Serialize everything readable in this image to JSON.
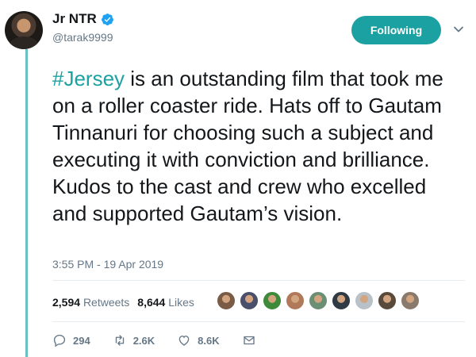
{
  "user": {
    "display_name": "Jr NTR",
    "handle": "@tarak9999",
    "follow_label": "Following"
  },
  "tweet": {
    "hashtag": "#Jersey",
    "body": " is an outstanding film that took me on a roller coaster ride. Hats off to Gautam Tinnanuri for choosing such a subject and executing it with conviction and brilliance. Kudos to the cast and crew who excelled and supported Gautam’s vision.",
    "timestamp": "3:55 PM - 19 Apr 2019"
  },
  "stats": {
    "retweets_count": "2,594",
    "retweets_label": "Retweets",
    "likes_count": "8,644",
    "likes_label": "Likes"
  },
  "likers": [
    {
      "color": "#7a5c46"
    },
    {
      "color": "#4a4f6b"
    },
    {
      "color": "#3c8a3a"
    },
    {
      "color": "#b07a5a"
    },
    {
      "color": "#6b8f74"
    },
    {
      "color": "#2f3a44"
    },
    {
      "color": "#b8c0c8"
    },
    {
      "color": "#5a4a3c"
    },
    {
      "color": "#8a7a6c"
    }
  ],
  "actions": {
    "reply_count": "294",
    "retweet_count": "2.6K",
    "like_count": "8.6K"
  },
  "colors": {
    "accent": "#1ba1a1",
    "muted": "#657786",
    "verified": "#1da1f2"
  }
}
